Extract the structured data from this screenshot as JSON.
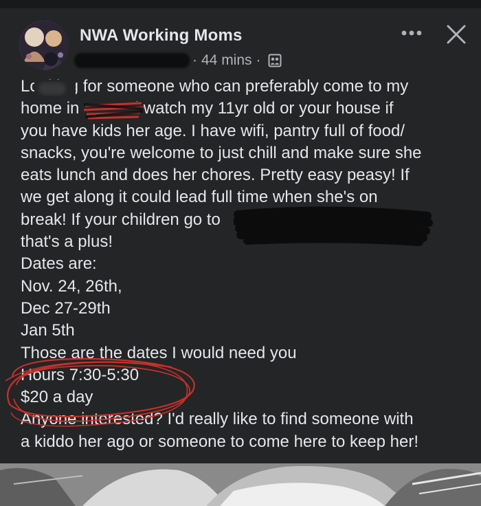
{
  "post": {
    "group_name": "NWA Working Moms",
    "meta_time": "44 mins",
    "meta_sep": "·",
    "text": "Looking for someone who can preferably come to my\nhome in       and watch my 11yr old or your house if\nyou have kids her age. I have wifi, pantry full of food/\nsnacks, you're welcome to just chill and make sure she\neats lunch and does her chores. Pretty easy peasy! If\nwe get along it could lead full time when she's on\nbreak! If your children go to\nthat's a plus!\nDates are:\nNov. 24, 26th,\nDec 27-29th\nJan 5th\nThose are the dates I would need you\nHours 7:30-5:30\n$20 a day\nAnyone interested? I'd really like to find someone with\na kiddo her ago or someone to come here to keep her!"
  },
  "icons": {
    "more": "more-horizontal-icon",
    "close": "close-icon",
    "privacy": "group-privacy-icon"
  },
  "colors": {
    "background": "#242526",
    "text": "#e4e6eb",
    "meta": "#b0b3b8",
    "annotation_red": "#c8302a"
  }
}
